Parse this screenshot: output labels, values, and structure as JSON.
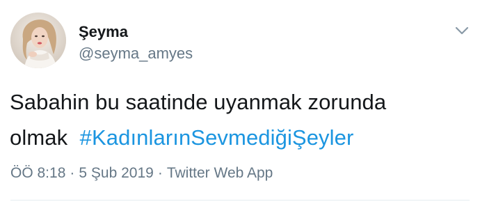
{
  "tweet": {
    "display_name": "Şeyma",
    "handle": "@seyma_amyes",
    "text_line1": "Sabahin bu saatinde uyanmak zorunda",
    "text_line2_prefix": "olmak",
    "hashtag": "#KadınlarınSevmediğiŞeyler",
    "time": "ÖÖ 8:18",
    "separator": "·",
    "date": "5 Şub 2019",
    "source": "Twitter Web App"
  },
  "icons": {
    "menu_caret": "chevron-down-icon",
    "avatar": "profile-photo"
  },
  "colors": {
    "text": "#14171a",
    "secondary": "#657786",
    "link": "#1b95e0",
    "divider": "#e6ecf0"
  }
}
